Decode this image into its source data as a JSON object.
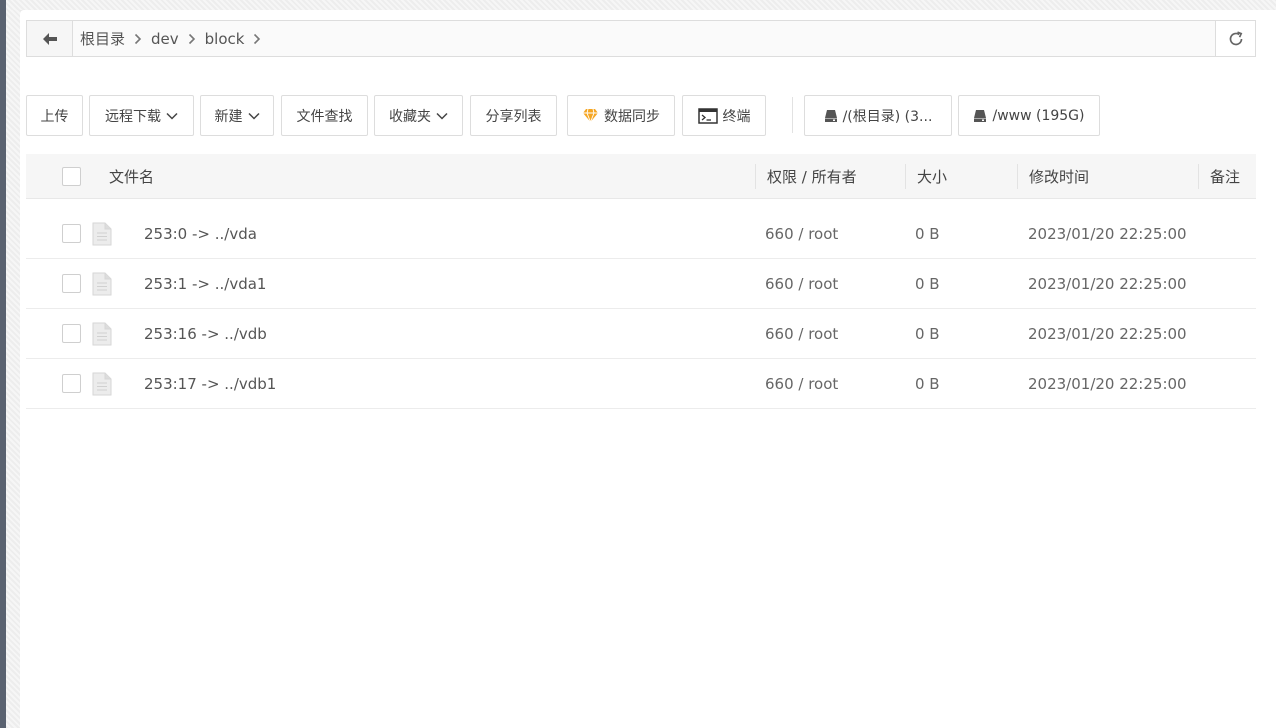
{
  "path": {
    "crumbs": [
      "根目录",
      "dev",
      "block"
    ]
  },
  "toolbar": {
    "upload": "上传",
    "remote_download": "远程下载",
    "new": "新建",
    "find": "文件查找",
    "favorites": "收藏夹",
    "share_list": "分享列表",
    "sync": "数据同步",
    "terminal": "终端",
    "disk_root": "/(根目录) (3...",
    "disk_www": "/www (195G)",
    "sync_icon_color": "#f5a623"
  },
  "table": {
    "headers": {
      "name": "文件名",
      "perm": "权限 / 所有者",
      "size": "大小",
      "mtime": "修改时间",
      "remark": "备注"
    },
    "rows": [
      {
        "name": "253:0 -> ../vda",
        "perm": "660 / root",
        "size": "0 B",
        "mtime": "2023/01/20 22:25:00"
      },
      {
        "name": "253:1 -> ../vda1",
        "perm": "660 / root",
        "size": "0 B",
        "mtime": "2023/01/20 22:25:00"
      },
      {
        "name": "253:16 -> ../vdb",
        "perm": "660 / root",
        "size": "0 B",
        "mtime": "2023/01/20 22:25:00"
      },
      {
        "name": "253:17 -> ../vdb1",
        "perm": "660 / root",
        "size": "0 B",
        "mtime": "2023/01/20 22:25:00"
      }
    ]
  }
}
